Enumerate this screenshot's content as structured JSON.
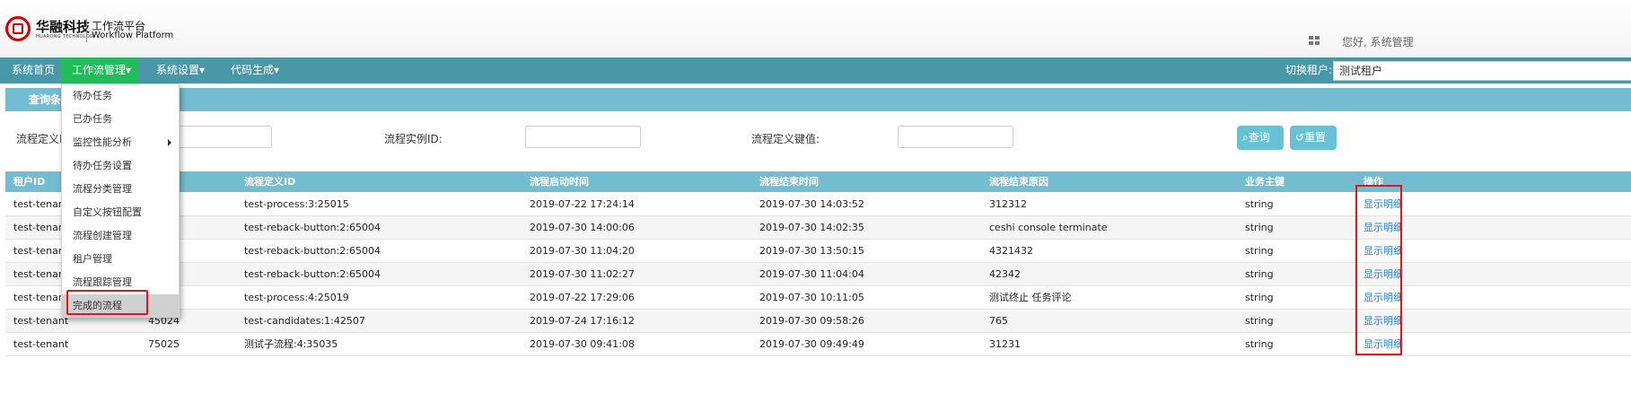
{
  "brand": {
    "name_cn": "华融科技",
    "name_en": "HUARONG TECHNOLOGY",
    "platform_cn": "工作流平台",
    "platform_en": "Workflow Platform"
  },
  "header": {
    "greeting": "您好, 系统管理"
  },
  "nav": {
    "items": [
      {
        "label": "系统首页"
      },
      {
        "label": "工作流管理▾"
      },
      {
        "label": "系统设置▾"
      },
      {
        "label": "代码生成▾"
      }
    ],
    "tenant_label": "切换租户:",
    "tenant_value": "测试租户"
  },
  "query": {
    "title": "查询条件",
    "label_def": "流程定义I",
    "label_instance": "流程实例ID:",
    "label_key": "流程定义键值:",
    "search_button": "查询",
    "reset_button": "重置"
  },
  "table": {
    "columns": [
      "租户ID",
      "流程定义ID",
      "流程启动时间",
      "流程结束时间",
      "流程结束原因",
      "业务主键",
      "操作"
    ],
    "rows": [
      {
        "tenant": "test-tenant",
        "id": "",
        "def": "test-process:3:25015",
        "start": "2019-07-22 17:24:14",
        "end": "2019-07-30 14:03:52",
        "reason": "312312",
        "key": "string",
        "op": "显示明细"
      },
      {
        "tenant": "test-tenant",
        "id": "",
        "def": "test-reback-button:2:65004",
        "start": "2019-07-30 14:00:06",
        "end": "2019-07-30 14:02:35",
        "reason": "ceshi console terminate",
        "key": "string",
        "op": "显示明细"
      },
      {
        "tenant": "test-tenant",
        "id": "",
        "def": "test-reback-button:2:65004",
        "start": "2019-07-30 11:04:20",
        "end": "2019-07-30 13:50:15",
        "reason": "4321432",
        "key": "string",
        "op": "显示明细"
      },
      {
        "tenant": "test-tenant",
        "id": "",
        "def": "test-reback-button:2:65004",
        "start": "2019-07-30 11:02:27",
        "end": "2019-07-30 11:04:04",
        "reason": "42342",
        "key": "string",
        "op": "显示明细"
      },
      {
        "tenant": "test-tenant",
        "id": "",
        "def": "test-process:4:25019",
        "start": "2019-07-22 17:29:06",
        "end": "2019-07-30 10:11:05",
        "reason": "测试终止 任务评论",
        "key": "string",
        "op": "显示明细"
      },
      {
        "tenant": "test-tenant",
        "id": "45024",
        "def": "test-candidates:1:42507",
        "start": "2019-07-24 17:16:12",
        "end": "2019-07-30 09:58:26",
        "reason": "765",
        "key": "string",
        "op": "显示明细"
      },
      {
        "tenant": "test-tenant",
        "id": "75025",
        "def": "测试子流程:4:35035",
        "start": "2019-07-30 09:41:08",
        "end": "2019-07-30 09:49:49",
        "reason": "31231",
        "key": "string",
        "op": "显示明细"
      }
    ]
  },
  "menu": {
    "items": [
      {
        "label": "待办任务"
      },
      {
        "label": "已办任务"
      },
      {
        "label": "监控性能分析"
      },
      {
        "label": "待办任务设置"
      },
      {
        "label": "流程分类管理"
      },
      {
        "label": "自定义按钮配置"
      },
      {
        "label": "流程创建管理"
      },
      {
        "label": "租户管理"
      },
      {
        "label": "流程跟踪管理"
      },
      {
        "label": "完成的流程"
      }
    ]
  },
  "colors": {
    "nav_bg": "#4898a8",
    "nav_active": "#22bd5a",
    "header_bar": "#74bccf",
    "link": "#1e7fd0",
    "highlight_border": "#e0161e"
  }
}
